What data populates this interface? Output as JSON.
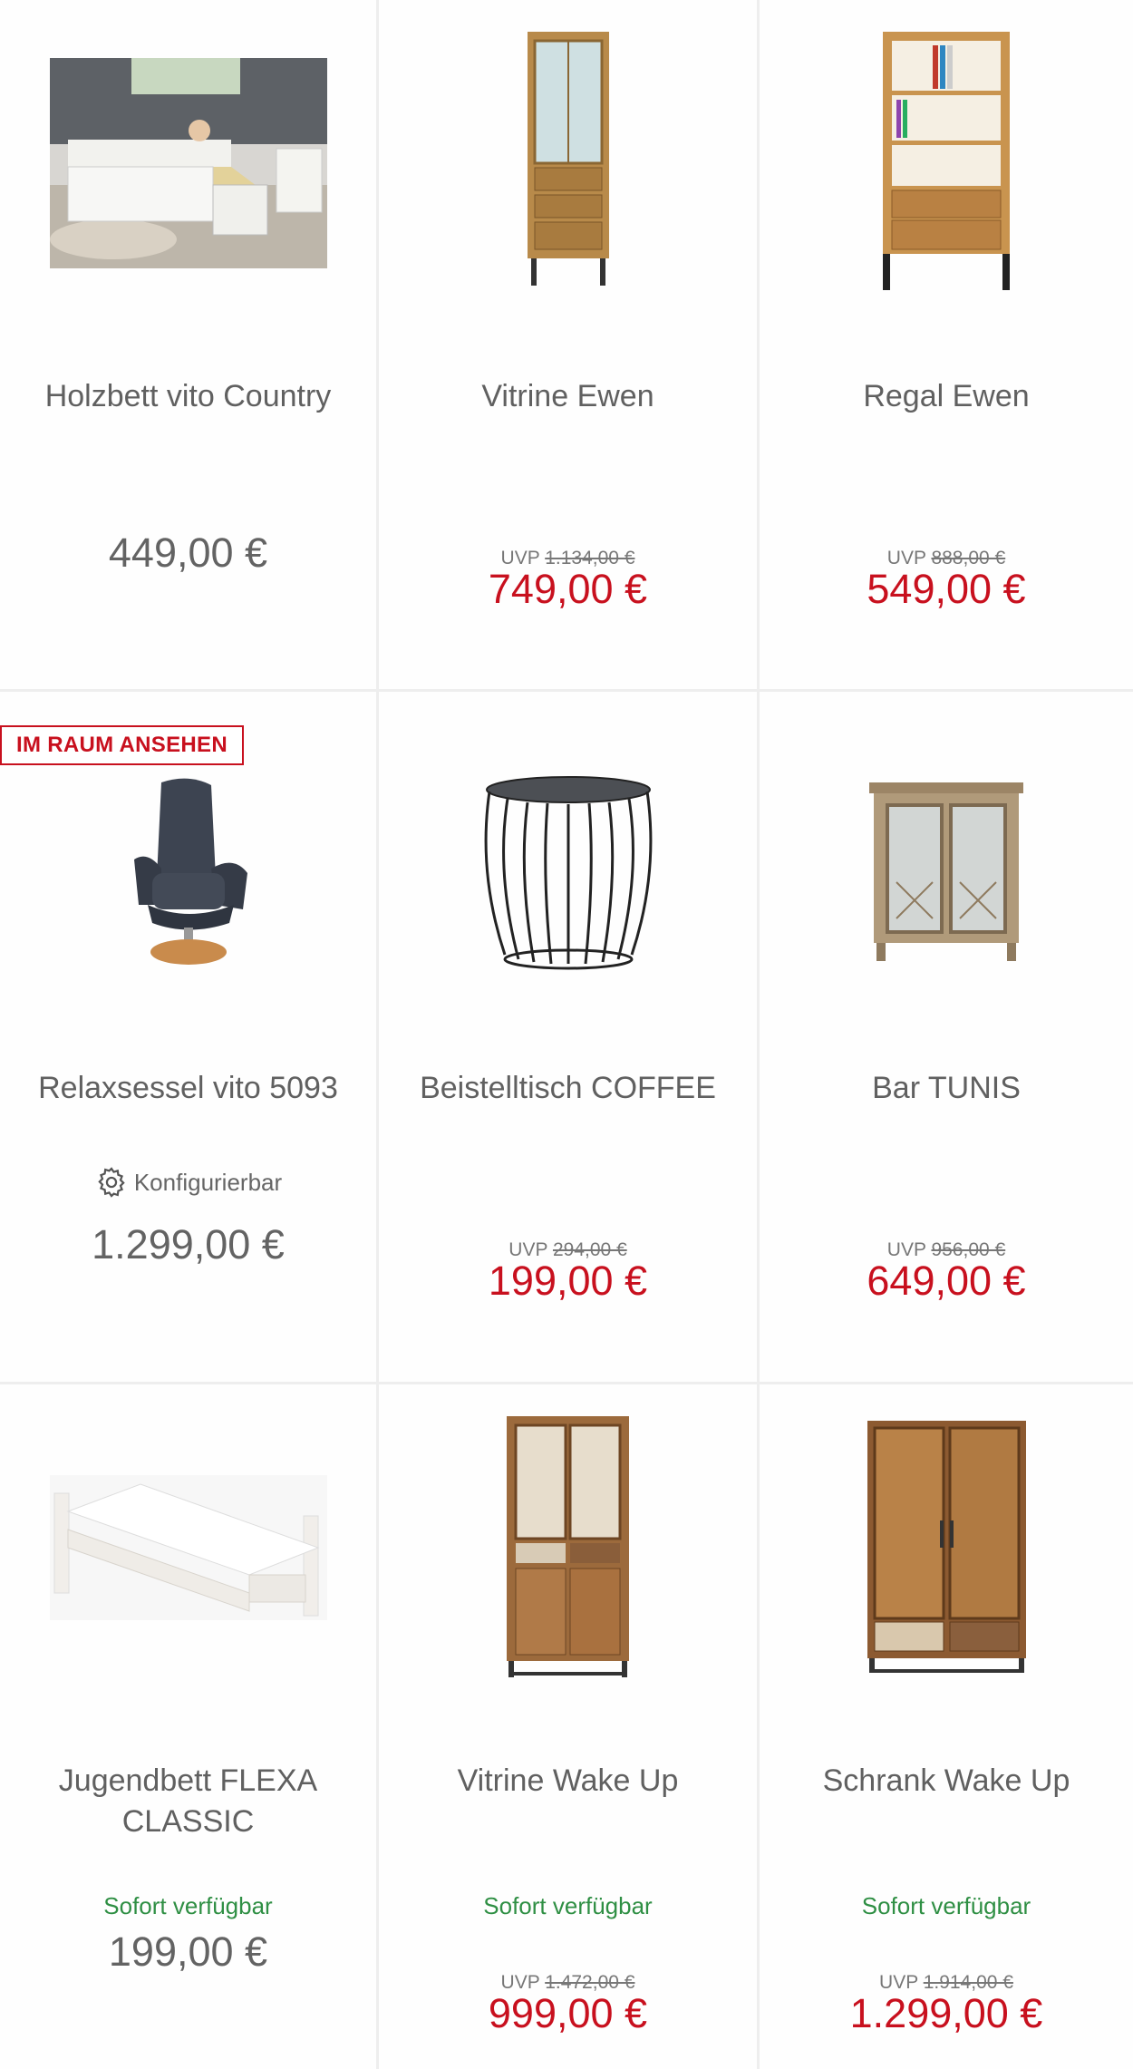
{
  "products": [
    {
      "name": "Holzbett vito Country",
      "price": "449,00 €",
      "image_icon": "bed-with-drawers-image"
    },
    {
      "name": "Vitrine Ewen",
      "uvp_label": "UVP",
      "uvp_price": "1.134,00 €",
      "price": "749,00 €",
      "image_icon": "tall-glass-cabinet-image"
    },
    {
      "name": "Regal Ewen",
      "uvp_label": "UVP",
      "uvp_price": "888,00 €",
      "price": "549,00 €",
      "image_icon": "bookshelf-image"
    },
    {
      "name": "Relaxsessel vito 5093",
      "badge": "IM RAUM ANSEHEN",
      "configurable": "Konfigurierbar",
      "price": "1.299,00 €",
      "image_icon": "recliner-chair-image"
    },
    {
      "name": "Beistelltisch COFFEE",
      "uvp_label": "UVP",
      "uvp_price": "294,00 €",
      "price": "199,00 €",
      "image_icon": "wire-side-table-image"
    },
    {
      "name": "Bar TUNIS",
      "uvp_label": "UVP",
      "uvp_price": "956,00 €",
      "price": "649,00 €",
      "image_icon": "bar-cabinet-image"
    },
    {
      "name": "Jugendbett FLEXA CLASSIC",
      "availability": "Sofort verfügbar",
      "price": "199,00 €",
      "image_icon": "white-single-bed-image"
    },
    {
      "name": "Vitrine Wake Up",
      "availability": "Sofort verfügbar",
      "uvp_label": "UVP",
      "uvp_price": "1.472,00 €",
      "price": "999,00 €",
      "image_icon": "wood-vitrine-image"
    },
    {
      "name": "Schrank Wake Up",
      "availability": "Sofort verfügbar",
      "uvp_label": "UVP",
      "uvp_price": "1.914,00 €",
      "price": "1.299,00 €",
      "image_icon": "wood-wardrobe-image"
    }
  ],
  "colors": {
    "sale_red": "#c8101e",
    "available_green": "#2f8f44",
    "text_gray": "#606060",
    "divider": "#eeeeee"
  }
}
